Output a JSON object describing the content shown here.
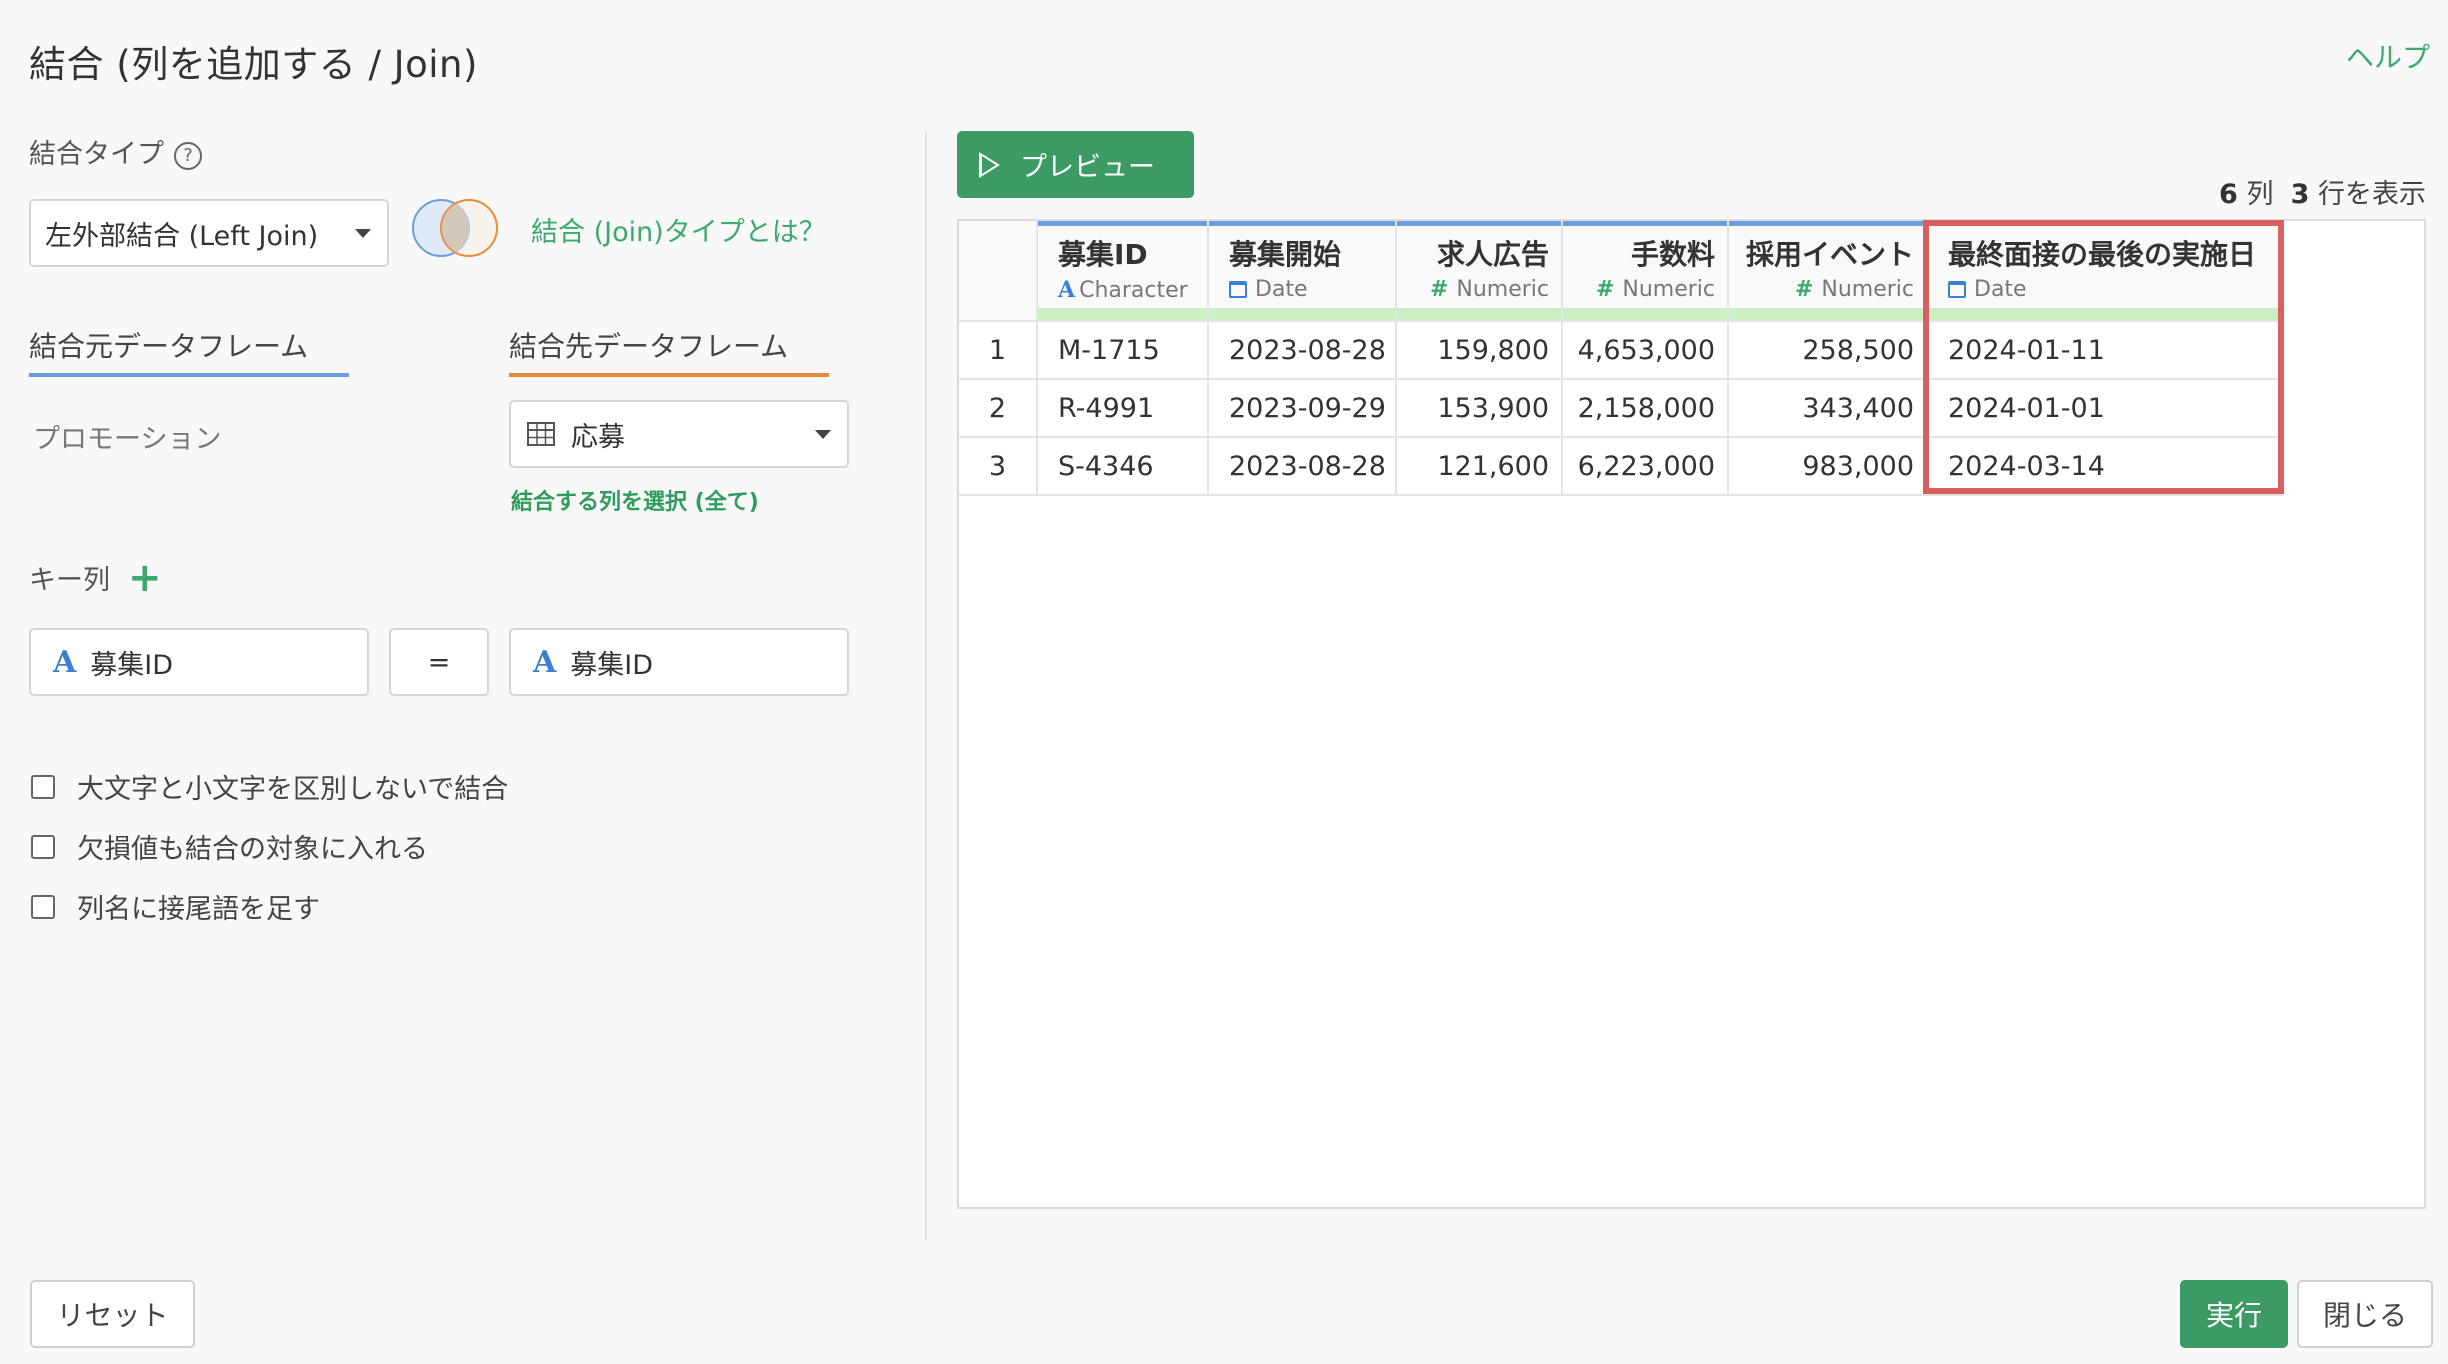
{
  "dialog": {
    "title": "結合 (列を追加する / Join)",
    "help_label": "ヘルプ"
  },
  "join_type": {
    "label": "結合タイプ",
    "help_icon": "?",
    "selected": "左外部結合 (Left Join)",
    "info_link": "結合 (Join)タイプとは？"
  },
  "tabs": {
    "source_label": "結合元データフレーム",
    "target_label": "結合先データフレーム"
  },
  "source_frame": "プロモーション",
  "target_frame": {
    "selected": "応募",
    "select_columns_link": "結合する列を選択 (全て)"
  },
  "key_columns": {
    "label": "キー列",
    "add_icon": "+",
    "left_key": "募集ID",
    "operator": "=",
    "right_key": "募集ID",
    "type_glyph": "A"
  },
  "options": [
    {
      "label": "大文字と小文字を区別しないで結合",
      "checked": false
    },
    {
      "label": "欠損値も結合の対象に入れる",
      "checked": false
    },
    {
      "label": "列名に接尾語を足す",
      "checked": false
    }
  ],
  "preview": {
    "button_label": "プレビュー",
    "col_count": "6",
    "col_unit": "列",
    "row_count": "3",
    "row_unit": "行を表示"
  },
  "table": {
    "columns": [
      {
        "name": "募集ID",
        "type": "Character",
        "type_icon": "A"
      },
      {
        "name": "募集開始",
        "type": "Date",
        "type_icon": "calendar-icon"
      },
      {
        "name": "求人広告",
        "type": "Numeric",
        "type_icon": "#"
      },
      {
        "name": "手数料",
        "type": "Numeric",
        "type_icon": "#"
      },
      {
        "name": "採用イベント",
        "type": "Numeric",
        "type_icon": "#"
      },
      {
        "name": "最終面接の最後の実施日",
        "type": "Date",
        "type_icon": "calendar-icon"
      }
    ],
    "rows": [
      [
        "1",
        "M-1715",
        "2023-08-28",
        "159,800",
        "4,653,000",
        "258,500",
        "2024-01-11"
      ],
      [
        "2",
        "R-4991",
        "2023-09-29",
        "153,900",
        "2,158,000",
        "343,400",
        "2024-01-01"
      ],
      [
        "3",
        "S-4346",
        "2023-08-28",
        "121,600",
        "6,223,000",
        "983,000",
        "2024-03-14"
      ]
    ]
  },
  "footer": {
    "reset_label": "リセット",
    "run_label": "実行",
    "close_label": "閉じる"
  },
  "colors": {
    "accent_green": "#3c9b64",
    "highlight_red": "#d9605e",
    "source_tab": "#6a9fdf",
    "target_tab": "#e98b3a"
  }
}
